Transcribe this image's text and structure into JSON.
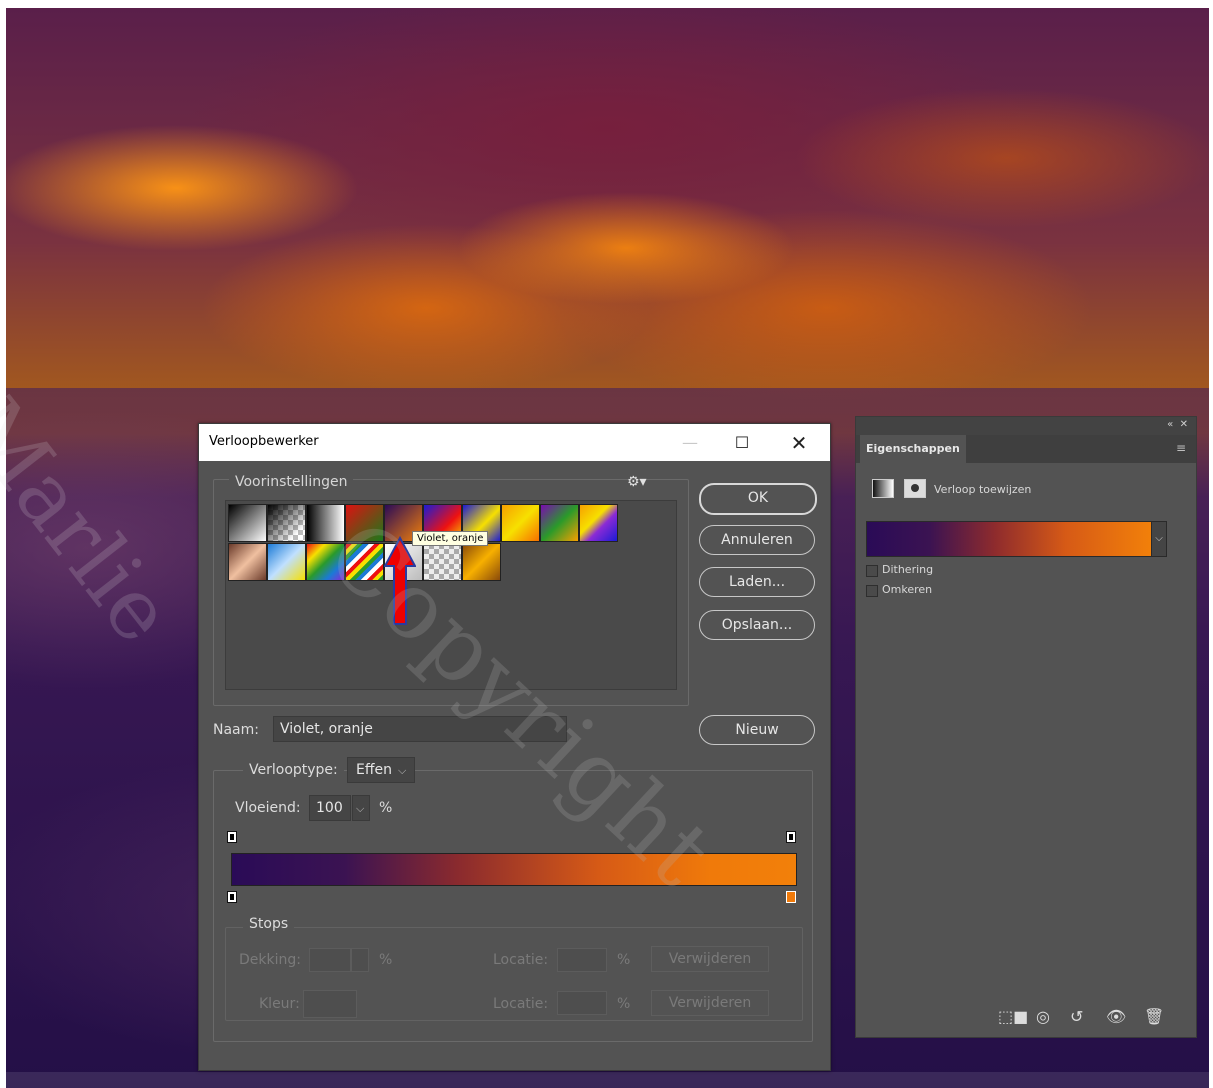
{
  "dialog": {
    "title": "Verloopbewerker",
    "presets_label": "Voorinstellingen",
    "tooltip": "Violet, oranje",
    "buttons": {
      "ok": "OK",
      "cancel": "Annuleren",
      "load": "Laden...",
      "save": "Opslaan...",
      "new": "Nieuw"
    },
    "name_label": "Naam:",
    "name_value": "Violet, oranje",
    "gradient_type_label": "Verlooptype:",
    "gradient_type_value": "Effen",
    "smoothness_label": "Vloeiend:",
    "smoothness_value": "100",
    "percent": "%",
    "stops_label": "Stops",
    "opacity_label": "Dekking:",
    "color_label": "Kleur:",
    "location_label": "Locatie:",
    "delete_label": "Verwijderen",
    "gradient_colors": [
      "#2a0b57",
      "#f2800a"
    ]
  },
  "panel": {
    "tab": "Eigenschappen",
    "title": "Verloop toewijzen",
    "dithering": "Dithering",
    "reverse": "Omkeren"
  },
  "watermark": {
    "text1": "Copyright",
    "text2": "Marlie"
  }
}
